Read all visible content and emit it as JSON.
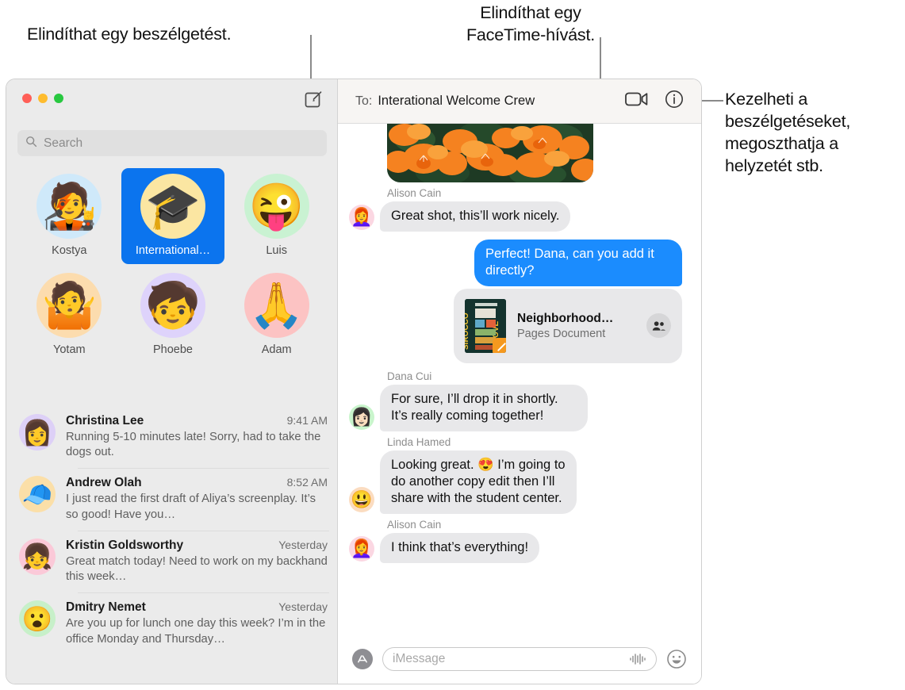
{
  "annotations": [
    {
      "id": "new-conversation",
      "text": "Elindíthat egy beszélgetést."
    },
    {
      "id": "facetime",
      "text": "Elindíthat egy\nFaceTime-hívást."
    },
    {
      "id": "details",
      "text": "Kezelheti a\nbeszélgetéseket,\nmegoszthatja a\nhelyzetét stb."
    }
  ],
  "window": {
    "traffic_lights": [
      "close",
      "minimize",
      "zoom"
    ]
  },
  "sidebar": {
    "compose_icon": "compose-icon",
    "search": {
      "placeholder": "Search",
      "icon": "search-icon"
    },
    "pinned": [
      {
        "name": "Kostya",
        "emoji": "🧑‍🎤",
        "bg": "#cfe9fa",
        "selected": false
      },
      {
        "name": "International…",
        "emoji": "🎓",
        "bg": "#fbe6a2",
        "selected": true
      },
      {
        "name": "Luis",
        "emoji": "😜",
        "bg": "#c9f2d2",
        "selected": false
      },
      {
        "name": "Yotam",
        "emoji": "🤷",
        "bg": "#fcdcae",
        "selected": false
      },
      {
        "name": "Phoebe",
        "emoji": "🧒",
        "bg": "#ded3fb",
        "selected": false
      },
      {
        "name": "Adam",
        "emoji": "🙏",
        "bg": "#fcc3c3",
        "selected": false
      }
    ],
    "conversations": [
      {
        "name": "Christina Lee",
        "time": "9:41 AM",
        "preview": "Running 5-10 minutes late! Sorry, had to take the dogs out.",
        "emoji": "👩",
        "bg": "#ddd0f7"
      },
      {
        "name": "Andrew Olah",
        "time": "8:52 AM",
        "preview": "I just read the first draft of Aliya’s screenplay. It’s so good! Have you…",
        "emoji": "🧢",
        "bg": "#fbdfa8"
      },
      {
        "name": "Kristin Goldsworthy",
        "time": "Yesterday",
        "preview": "Great match today! Need to work on my backhand this week…",
        "emoji": "👧",
        "bg": "#fbc9d8"
      },
      {
        "name": "Dmitry Nemet",
        "time": "Yesterday",
        "preview": "Are you up for lunch one day this week? I’m in the office Monday and Thursday…",
        "emoji": "😮",
        "bg": "#c7f0c9"
      }
    ]
  },
  "chat": {
    "header": {
      "to_label": "To:",
      "recipient": "Interational Welcome Crew",
      "facetime_icon": "video-camera-icon",
      "details_icon": "info-circle-icon"
    },
    "photo_alt": "orange-pansy-flowers-photo",
    "messages": [
      {
        "type": "text",
        "direction": "in",
        "sender": "Alison Cain",
        "text": "Great shot, this’ll work nicely.",
        "emoji": "👩‍🦰",
        "bg": "#fbd7e2"
      },
      {
        "type": "text",
        "direction": "out",
        "sender": "",
        "text": "Perfect! Dana, can you add it directly?"
      },
      {
        "type": "attachment",
        "direction": "out",
        "title": "Neighborhood…",
        "subtitle": "Pages Document",
        "thumb_text": "SIROCCO GROVE",
        "shared_icon": "shared-people-icon",
        "app_icon": "pages-icon"
      },
      {
        "type": "text",
        "direction": "in",
        "sender": "Dana Cui",
        "text": "For sure, I’ll drop it in shortly. It’s really coming together!",
        "emoji": "👩🏻",
        "bg": "#c9f5cc"
      },
      {
        "type": "text",
        "direction": "in",
        "sender": "Linda Hamed",
        "text": "Looking great. 😍 I’m going to do another copy edit then I’ll share with the student center.",
        "emoji": "😃",
        "bg": "#fbdcc0"
      },
      {
        "type": "text",
        "direction": "in",
        "sender": "Alison Cain",
        "text": "I think that’s everything!",
        "emoji": "👩‍🦰",
        "bg": "#fbd7e2"
      }
    ],
    "composer": {
      "apps_icon": "app-store-icon",
      "input_placeholder": "iMessage",
      "audio_icon": "audio-waveform-icon",
      "emoji_icon": "smiley-face-icon"
    }
  },
  "colors": {
    "accent_blue": "#1b8cfe",
    "selected_pin": "#0b74ee",
    "incoming_bubble": "#e8e8ea",
    "sidebar_bg": "#ebebeb",
    "header_bg": "#f7f5f3"
  }
}
